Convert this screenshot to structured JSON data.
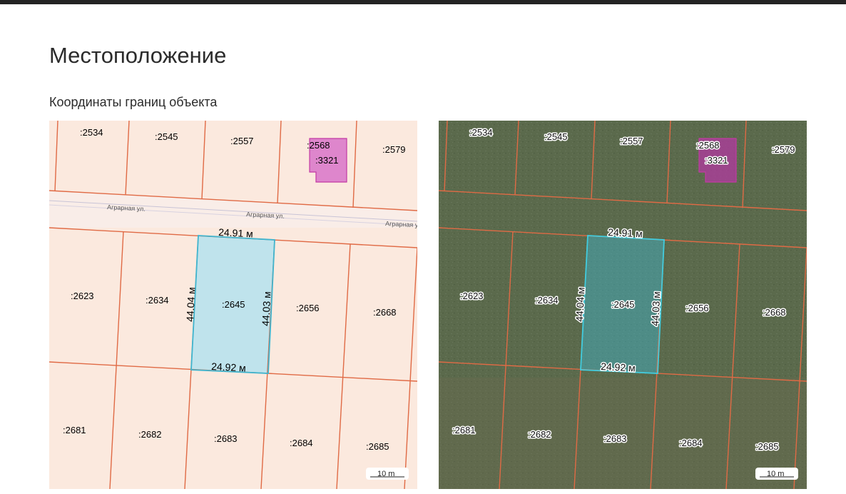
{
  "page": {
    "title": "Местоположение",
    "subtitle": "Координаты границ объекта"
  },
  "parcel": {
    "label": ":2645",
    "top_length": "24.91 м",
    "bottom_length": "24.92 м",
    "left_length": "44.04 м",
    "right_length": "44.03 м"
  },
  "neighbors": {
    "n2534": ":2534",
    "n2545": ":2545",
    "n2557": ":2557",
    "n2568": ":2568",
    "n3321": ":3321",
    "n2579": ":2579",
    "n2623": ":2623",
    "n2634": ":2634",
    "n2656": ":2656",
    "n2668": ":2668",
    "n2681": ":2681",
    "n2682": ":2682",
    "n2683": ":2683",
    "n2684": ":2684",
    "n2685": ":2685"
  },
  "street": {
    "name": "Аграрная ул.",
    "name_cut": "Аграрная у"
  },
  "scale_bar": {
    "label": "10 m"
  },
  "colors": {
    "cadastral_bg": "#fbe9de",
    "parcel_line": "#e06a45",
    "selected_fill": "#bfe3ec",
    "selected_stroke": "#3fb5cf",
    "building_fill": "#de86cc",
    "building_stroke": "#c23aa4",
    "satellite_bg": "#5b6a4c"
  }
}
